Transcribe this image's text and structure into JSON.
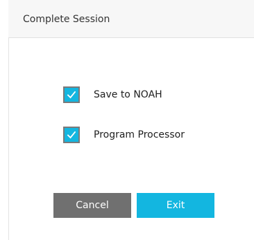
{
  "dialog": {
    "title": "Complete Session"
  },
  "options": [
    {
      "label": "Save to NOAH",
      "checked": true
    },
    {
      "label": "Program Processor",
      "checked": true
    }
  ],
  "buttons": {
    "cancel_label": "Cancel",
    "exit_label": "Exit"
  },
  "colors": {
    "accent": "#13b6e0",
    "cancel_button": "#707070",
    "header_background": "#f7f7f7"
  },
  "icons": {
    "checkmark": "check-icon"
  }
}
